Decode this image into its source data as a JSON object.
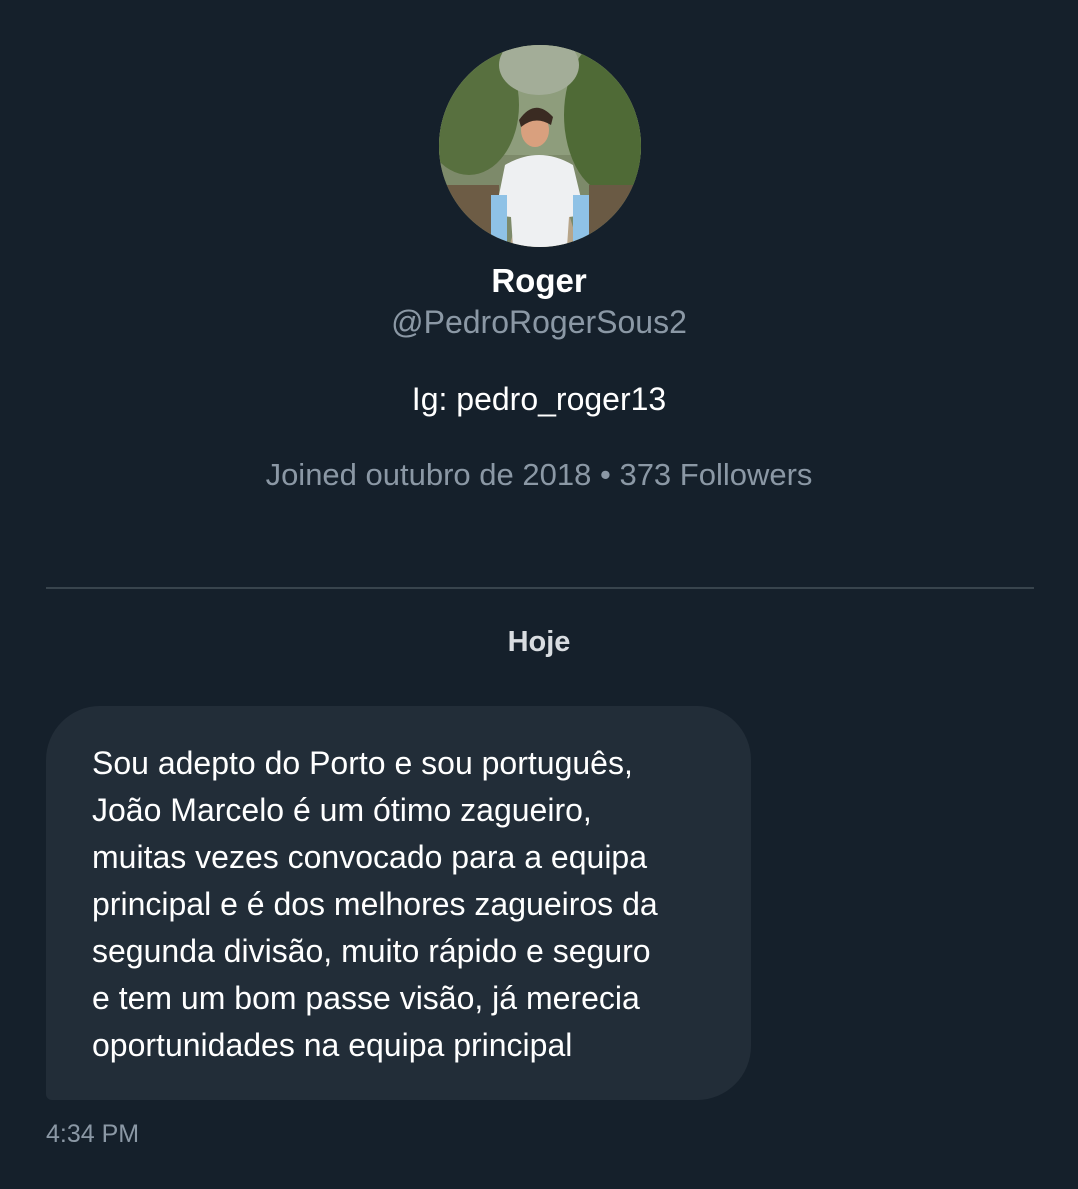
{
  "profile": {
    "display_name": "Roger",
    "handle": "@PedroRogerSous2",
    "bio": "Ig: pedro_roger13",
    "joined": "Joined outubro de 2018",
    "separator": "•",
    "followers": "373 Followers"
  },
  "conversation": {
    "date_separator": "Hoje",
    "messages": [
      {
        "text": "Sou adepto do Porto e sou português,\nJoão Marcelo é um ótimo zagueiro,\nmuitas vezes convocado para a equipa\nprincipal e é dos melhores zagueiros da\nsegunda divisão, muito rápido e seguro\ne tem um bom passe visão, já merecia\noportunidades na equipa principal",
        "time": "4:34 PM"
      }
    ]
  },
  "colors": {
    "background": "#15202b",
    "bubble": "#222d38",
    "secondary_text": "#8b98a5",
    "divider": "#38444d"
  }
}
